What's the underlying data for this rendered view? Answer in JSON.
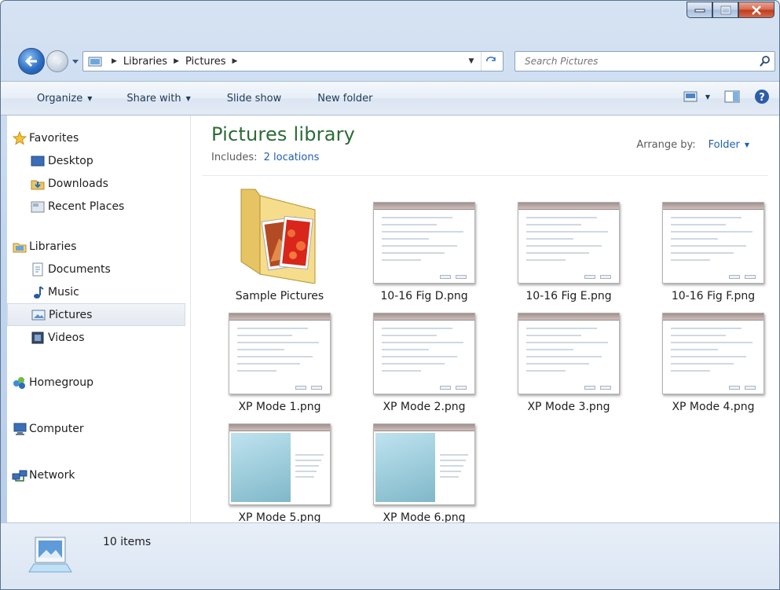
{
  "window": {
    "caption_buttons": [
      "minimize",
      "maximize",
      "close"
    ]
  },
  "address": {
    "crumbs": [
      "Libraries",
      "Pictures"
    ],
    "search_placeholder": "Search Pictures"
  },
  "toolbar": {
    "organize": "Organize",
    "share_with": "Share with",
    "slide_show": "Slide show",
    "new_folder": "New folder"
  },
  "nav": {
    "favorites": {
      "label": "Favorites",
      "items": [
        "Desktop",
        "Downloads",
        "Recent Places"
      ]
    },
    "libraries": {
      "label": "Libraries",
      "items": [
        "Documents",
        "Music",
        "Pictures",
        "Videos"
      ]
    },
    "homegroup": "Homegroup",
    "computer": "Computer",
    "network": "Network",
    "selected": "Pictures"
  },
  "library": {
    "title": "Pictures library",
    "includes_label": "Includes:",
    "locations": "2 locations",
    "arrange_label": "Arrange by:",
    "arrange_value": "Folder"
  },
  "files": [
    {
      "name": "Sample Pictures",
      "kind": "folder"
    },
    {
      "name": "10-16 Fig D.png",
      "kind": "image"
    },
    {
      "name": "10-16 Fig E.png",
      "kind": "image"
    },
    {
      "name": "10-16 Fig F.png",
      "kind": "image"
    },
    {
      "name": "XP Mode 1.png",
      "kind": "image"
    },
    {
      "name": "XP Mode 2.png",
      "kind": "image"
    },
    {
      "name": "XP Mode 3.png",
      "kind": "image"
    },
    {
      "name": "XP Mode 4.png",
      "kind": "image"
    },
    {
      "name": "XP Mode 5.png",
      "kind": "image"
    },
    {
      "name": "XP Mode 6.png",
      "kind": "image"
    }
  ],
  "status": {
    "count": "10 items"
  },
  "colors": {
    "library_title": "#2b6b36",
    "link": "#1f5fb4",
    "close_button": "#c1391c"
  }
}
